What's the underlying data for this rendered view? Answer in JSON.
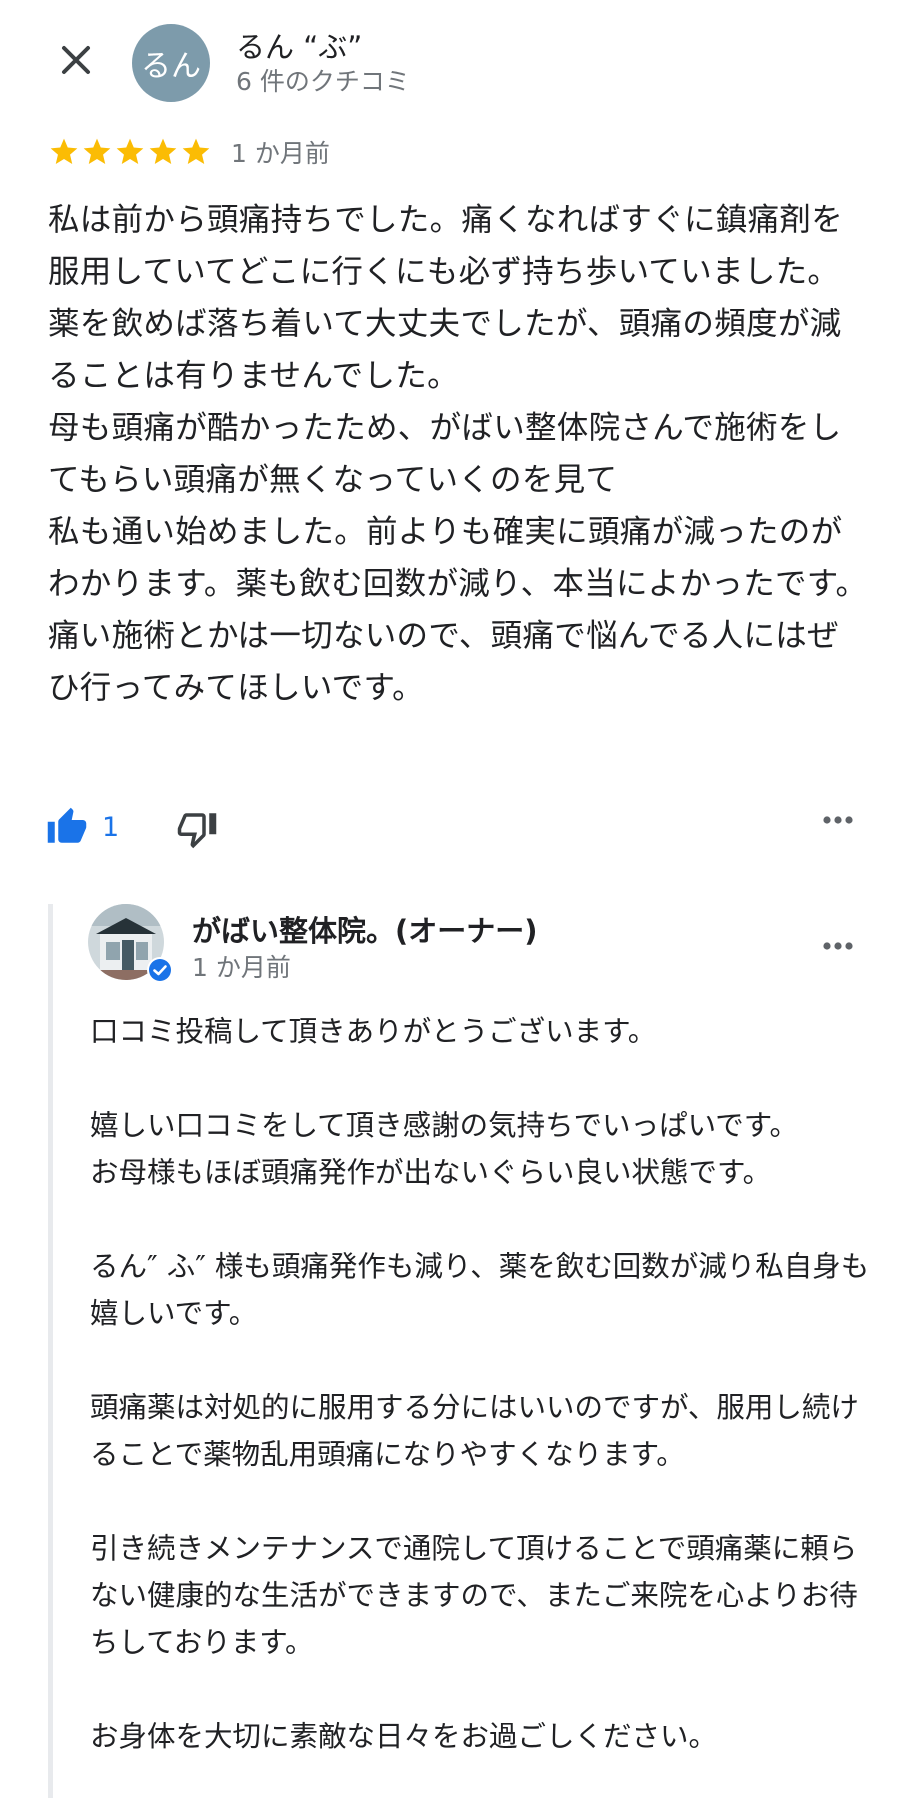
{
  "header": {
    "avatar_initial": "るん",
    "reviewer_name": "るん “ぶ”",
    "review_count": "6 件のクチコミ"
  },
  "review": {
    "rating": 5,
    "rating_max": 5,
    "star_color": "#fbbc04",
    "date": "1 か月前",
    "text": "私は前から頭痛持ちでした。痛くなればすぐに鎮痛剤を服用していてどこに行くにも必ず持ち歩いていました。薬を飲めば落ち着いて大丈夫でしたが、頭痛の頻度が減ることは有りませんでした。\n母も頭痛が酷かったため、がばい整体院さんで施術をしてもらい頭痛が無くなっていくのを見て\n私も通い始めました。前よりも確実に頭痛が減ったのがわかります。薬も飲む回数が減り、本当によかったです。\n痛い施術とかは一切ないので、頭痛で悩んでる人にはぜひ行ってみてほしいです。"
  },
  "actions": {
    "like_count": "1",
    "like_color": "#1a73e8"
  },
  "reply": {
    "owner_name": "がばい整体院。(オーナー)",
    "date": "1 か月前",
    "text": "口コミ投稿して頂きありがとうございます。\n\n嬉しい口コミをして頂き感謝の気持ちでいっぱいです。\nお母様もほぼ頭痛発作が出ないぐらい良い状態です。\n\nるん″ ふ″ 様も頭痛発作も減り、薬を飲む回数が減り私自身も嬉しいです。\n\n頭痛薬は対処的に服用する分にはいいのですが、服用し続けることで薬物乱用頭痛になりやすくなります。\n\n引き続きメンテナンスで通院して頂けることで頭痛薬に頼らない健康的な生活ができますので、またご来院を心よりお待ちしております。\n\nお身体を大切に素敵な日々をお過ごしください。"
  }
}
